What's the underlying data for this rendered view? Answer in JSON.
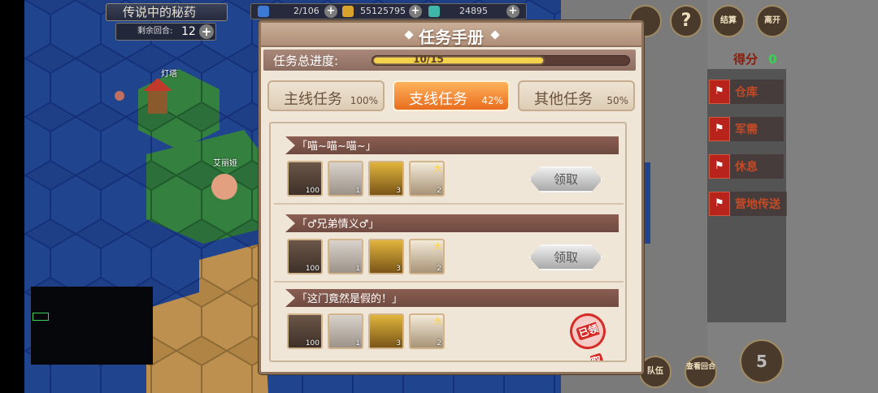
{
  "hud": {
    "map_title": "传说中的秘药",
    "turns_label": "剩余回合:",
    "turns_value": "12",
    "plus": "+",
    "resources": [
      {
        "icon": "lightning-icon",
        "value": "2/106"
      },
      {
        "icon": "gold-ingot-icon",
        "value": "55125795"
      },
      {
        "icon": "gem-icon",
        "value": "24895"
      }
    ]
  },
  "map_labels": {
    "lighthouse": "灯塔",
    "player": "艾丽娅"
  },
  "right_hud": {
    "help": "?",
    "settle": "结算",
    "leave": "离开",
    "score_label": "得分",
    "score_value": "0",
    "side_items": [
      "仓库",
      "军需",
      "休息",
      "营地传送"
    ],
    "bottom_buttons": [
      "队伍",
      "查看回合"
    ],
    "attack_count": "5"
  },
  "dialog": {
    "title": "任务手册",
    "progress_label": "任务总进度:",
    "progress_text": "10/15",
    "progress_fraction": 0.667,
    "tabs": [
      {
        "label": "主线任务",
        "percent": "100%",
        "active": false
      },
      {
        "label": "支线任务",
        "percent": "42%",
        "active": true
      },
      {
        "label": "其他任务",
        "percent": "50%",
        "active": false
      }
    ],
    "quests": [
      {
        "name": "「喵~喵~喵~」",
        "rewards": [
          "100",
          "1",
          "3",
          "2"
        ],
        "claim_label": "领取",
        "claimed": false
      },
      {
        "name": "「♂兄弟情义♂」",
        "rewards": [
          "100",
          "1",
          "3",
          "2"
        ],
        "claim_label": "领取",
        "claimed": false
      },
      {
        "name": "「这门竟然是假的！」",
        "rewards": [
          "100",
          "1",
          "3",
          "2"
        ],
        "claim_label": "已领取",
        "claimed": true
      }
    ],
    "reward_icons": [
      "crystal-bundle-icon",
      "scroll-icon",
      "treasure-chest-icon",
      "star-scroll-icon"
    ],
    "reward_star": "大"
  },
  "colors": {
    "accent": "#e86d1e",
    "dialog_bg": "#efe6d7",
    "header": "#b08f79",
    "quest_bar": "#7a5247",
    "progress_fill": "#f5d24c",
    "stamp": "#d62c28"
  }
}
